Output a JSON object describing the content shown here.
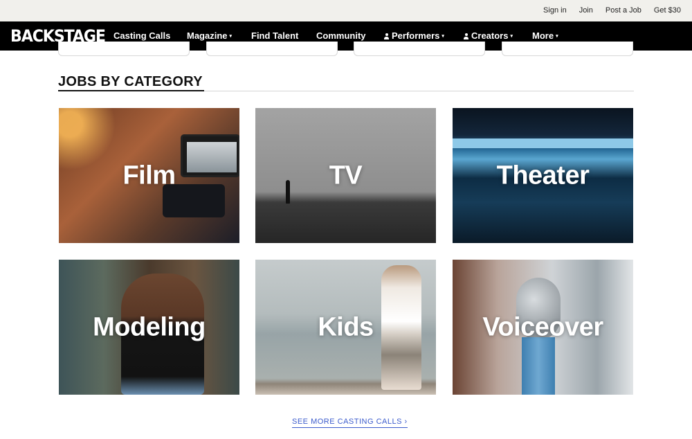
{
  "topbar": {
    "links": [
      "Sign in",
      "Join",
      "Post a Job",
      "Get $30"
    ]
  },
  "nav": {
    "logo": "BACKSTAGE",
    "items": [
      {
        "label": "Casting Calls"
      },
      {
        "label": "Magazine",
        "caret": "▾"
      },
      {
        "label": "Find Talent"
      },
      {
        "label": "Community"
      },
      {
        "label": "Performers",
        "caret": "▾"
      },
      {
        "label": "Creators",
        "caret": "▾"
      },
      {
        "label": "More",
        "caret": "▾"
      }
    ]
  },
  "section": {
    "title": "JOBS BY CATEGORY"
  },
  "categories": [
    {
      "label": "Film"
    },
    {
      "label": "TV"
    },
    {
      "label": "Theater"
    },
    {
      "label": "Modeling"
    },
    {
      "label": "Kids"
    },
    {
      "label": "Voiceover"
    }
  ],
  "footer": {
    "see_more": "SEE MORE CASTING CALLS ›"
  },
  "colors": {
    "nav_bg": "#000000",
    "topbar_bg": "#f1f0ec",
    "link_blue": "#3b5bcc"
  }
}
